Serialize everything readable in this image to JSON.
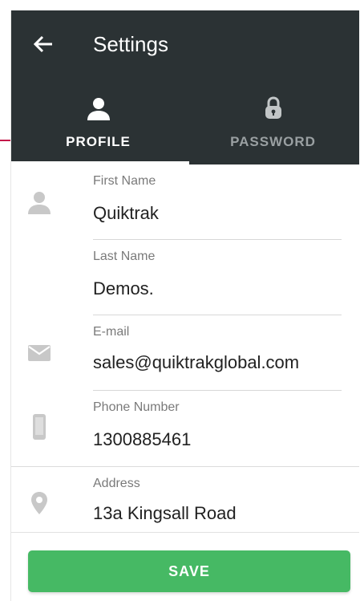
{
  "appbar": {
    "title": "Settings",
    "back_icon": "arrow-left-icon"
  },
  "tabs": [
    {
      "label": "PROFILE",
      "icon": "person-icon",
      "active": true
    },
    {
      "label": "PASSWORD",
      "icon": "lock-icon",
      "active": false
    }
  ],
  "form": {
    "first_name": {
      "label": "First Name",
      "value": "Quiktrak",
      "icon": "person-icon"
    },
    "last_name": {
      "label": "Last Name",
      "value": "Demos."
    },
    "email": {
      "label": "E-mail",
      "value": "sales@quiktrakglobal.com",
      "icon": "mail-icon"
    },
    "phone": {
      "label": "Phone Number",
      "value": "1300885461",
      "icon": "mobile-phone-icon"
    },
    "address": {
      "label": "Address",
      "value": "13a Kingsall Road",
      "icon": "location-pin-icon"
    }
  },
  "save_label": "SAVE",
  "colors": {
    "appbar_bg": "#2b3234",
    "accent_green": "#46b964",
    "annotation_arrow": "#c4184a"
  }
}
